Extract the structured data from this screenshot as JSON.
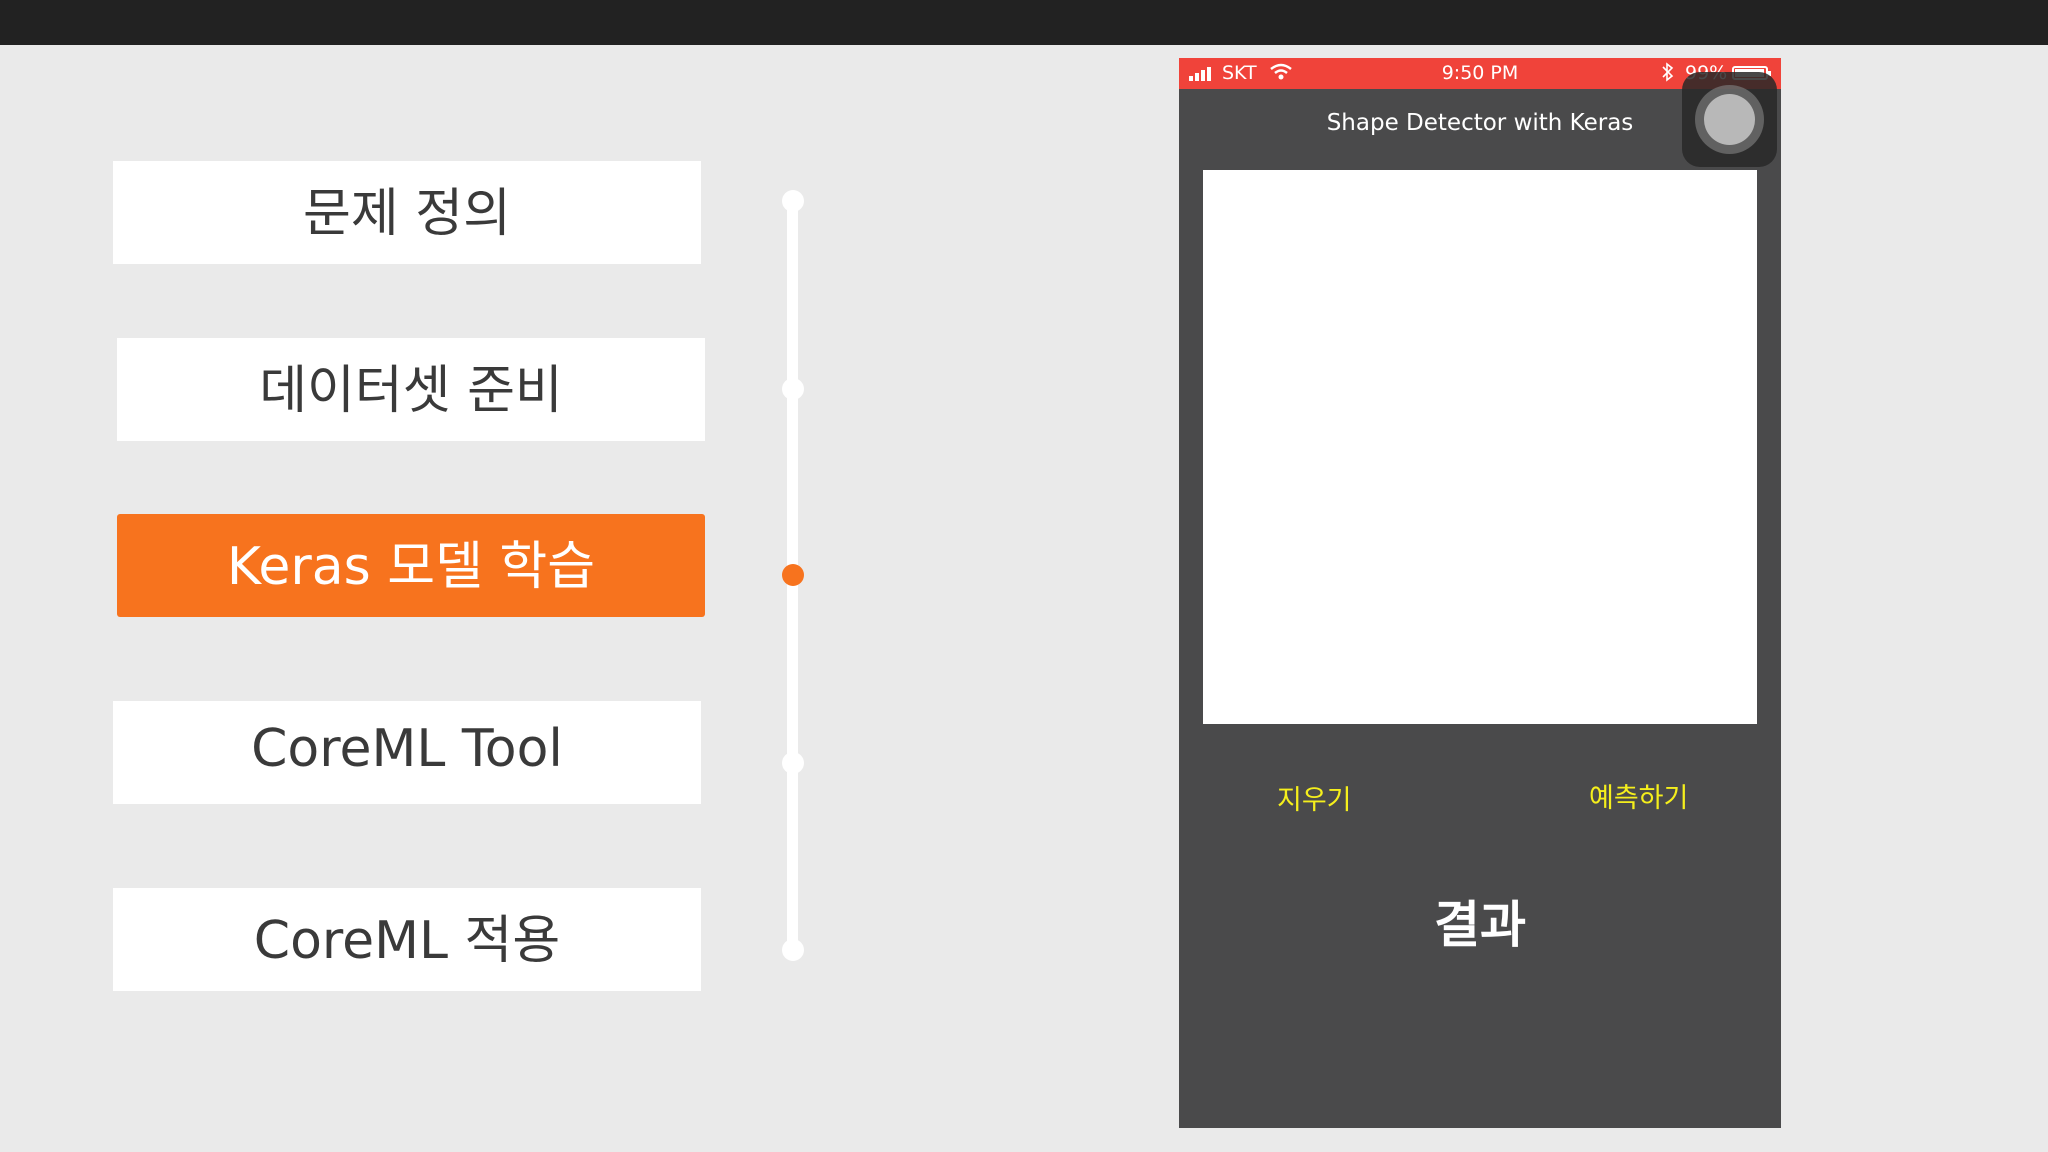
{
  "steps": [
    {
      "label": "문제 정의",
      "active": false
    },
    {
      "label": "데이터셋 준비",
      "active": false
    },
    {
      "label": "Keras 모델 학습",
      "active": true
    },
    {
      "label": "CoreML Tool",
      "active": false
    },
    {
      "label": "CoreML 적용",
      "active": false
    }
  ],
  "colors": {
    "accent": "#f7731e",
    "status_bar": "#f0433a",
    "phone_bg": "#4a4a4b",
    "button_text": "#f5ef1c"
  },
  "phone": {
    "status": {
      "carrier": "SKT",
      "time": "9:50 PM",
      "battery": "99%"
    },
    "title": "Shape Detector with Keras",
    "clear_label": "지우기",
    "predict_label": "예측하기",
    "result_label": "결과"
  }
}
